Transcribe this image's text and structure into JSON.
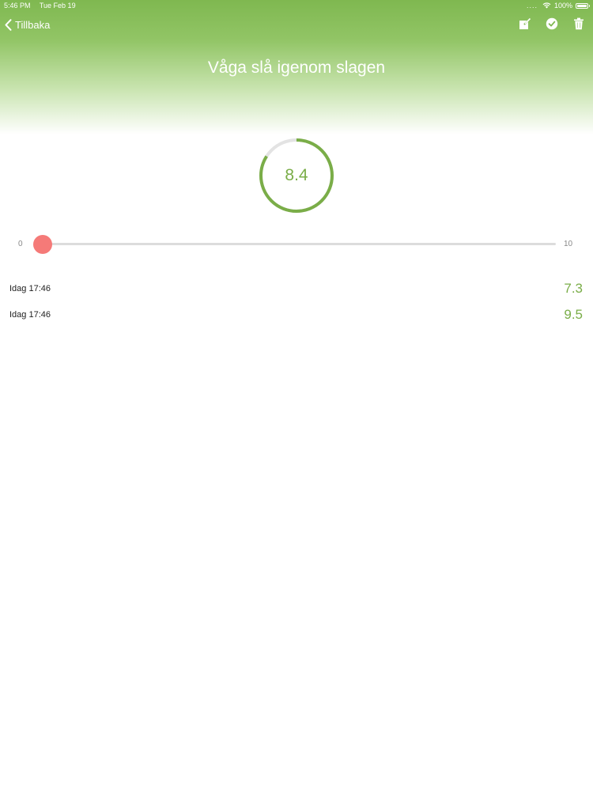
{
  "status_bar": {
    "time": "5:46 PM",
    "date": "Tue Feb 19",
    "signal": "....",
    "battery": "100%"
  },
  "nav": {
    "back_label": "Tillbaka",
    "icons": [
      "edit-icon",
      "checkmark-icon",
      "trash-icon"
    ]
  },
  "title": "Våga slå igenom slagen",
  "score": {
    "value": "8.4",
    "max": 10
  },
  "slider": {
    "min_label": "0",
    "max_label": "10",
    "value": 0
  },
  "entries": [
    {
      "date": "Idag 17:46",
      "score": "7.3"
    },
    {
      "date": "Idag 17:46",
      "score": "9.5"
    }
  ],
  "colors": {
    "accent": "#7aad48",
    "header_green": "#7fb850",
    "slider_thumb": "#f57a78",
    "ring_track": "#e3e3e3"
  }
}
